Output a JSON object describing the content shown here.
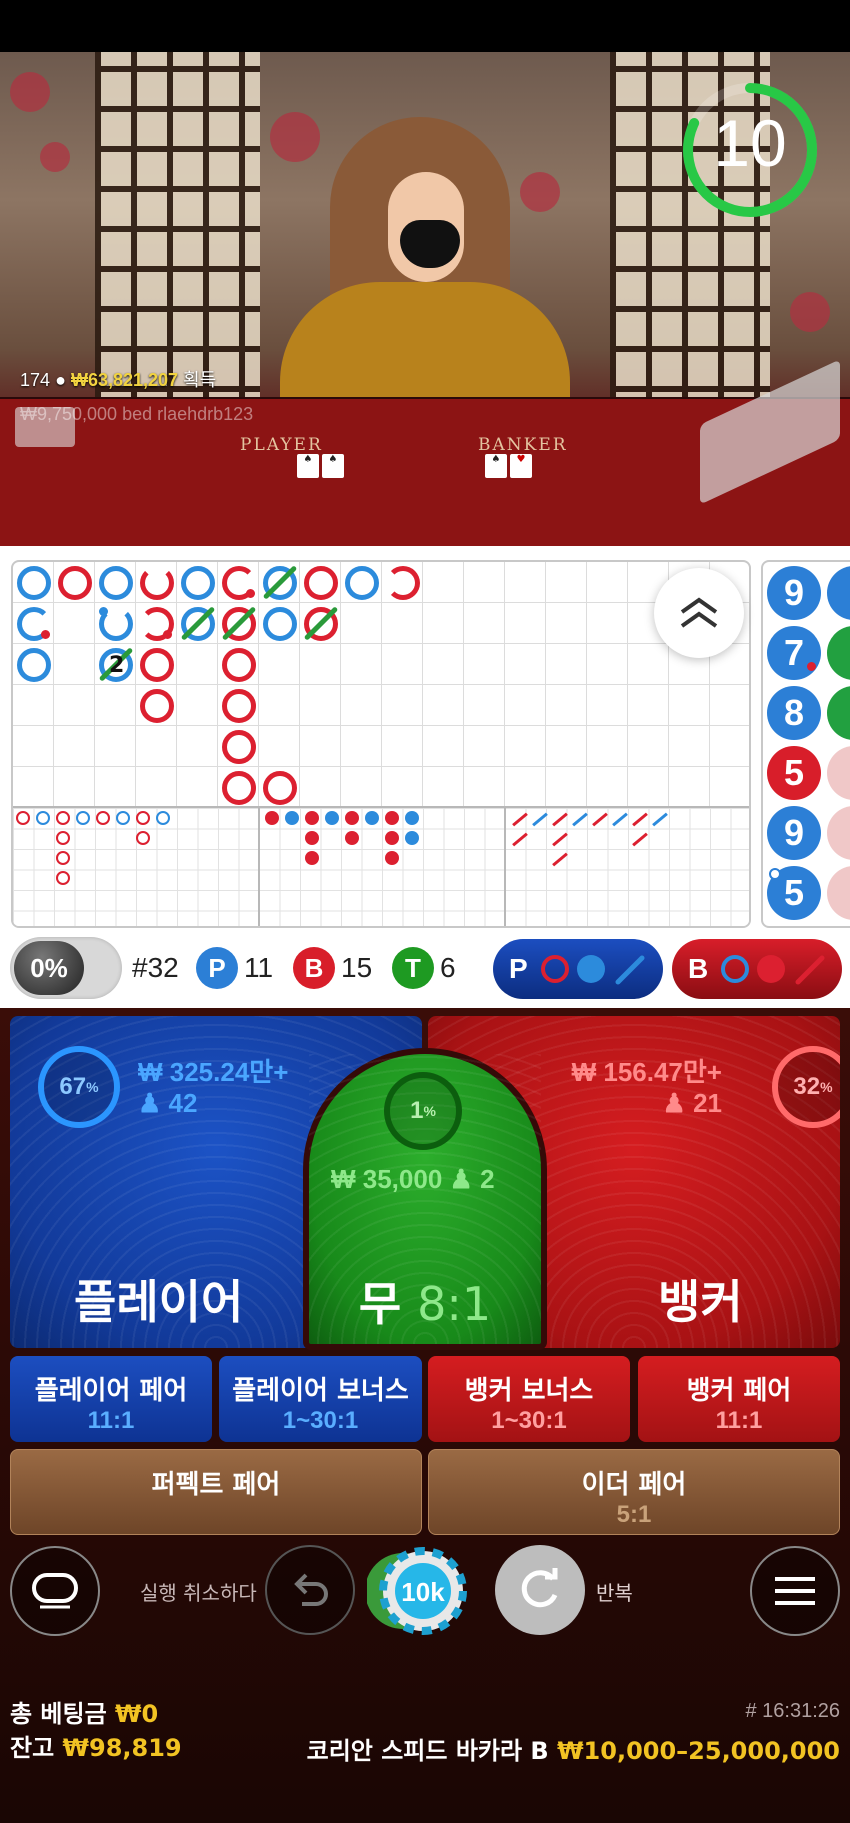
{
  "video": {
    "timer": "10",
    "viewer_count": "174",
    "total_win": "₩63,821,207",
    "total_win_suffix": "획득",
    "winner_ticker": "₩9,750,000  bed  rlaehdrb123",
    "table_player_label": "PLAYER",
    "table_banker_label": "BANKER"
  },
  "roadmap": {
    "bead_values": [
      "9",
      "7",
      "8",
      "5",
      "9",
      "5"
    ],
    "big_road_tie_count": "2"
  },
  "stats": {
    "percent_toggle": "0%",
    "round": "#32",
    "player_badge": "P",
    "player_count": "11",
    "banker_badge": "B",
    "banker_count": "15",
    "tie_badge": "T",
    "tie_count": "6",
    "player_predict": "P",
    "banker_predict": "B"
  },
  "bets": {
    "player": {
      "percent": "67",
      "pct_sign": "%",
      "amount": "₩ 325.24만+",
      "players": "42",
      "title": "플레이어"
    },
    "banker": {
      "percent": "32",
      "pct_sign": "%",
      "amount": "₩ 156.47만+",
      "players": "21",
      "title": "뱅커"
    },
    "tie": {
      "percent": "1",
      "pct_sign": "%",
      "amount": "₩ 35,000",
      "players": "2",
      "title": "무",
      "odds": "8:1"
    },
    "player_pair": {
      "title": "플레이어 페어",
      "odds": "11:1"
    },
    "player_bonus": {
      "title": "플레이어 보너스",
      "odds": "1~30:1"
    },
    "banker_bonus": {
      "title": "뱅커 보너스",
      "odds": "1~30:1"
    },
    "banker_pair": {
      "title": "뱅커 페어",
      "odds": "11:1"
    },
    "perfect_pair": {
      "title": "퍼펙트 페어"
    },
    "either_pair": {
      "title": "이더 페어",
      "odds": "5:1"
    }
  },
  "controls": {
    "undo_label": "실행 취소하다",
    "chip_value": "10k",
    "repeat_label": "반복"
  },
  "footer": {
    "total_bet_label": "총 베팅금",
    "total_bet": "₩0",
    "balance_label": "잔고",
    "balance": "₩98,819",
    "time": "# 16:31:26",
    "table_name": "코리안 스피드 바카라 B",
    "limits": "₩10,000–25,000,000"
  },
  "colors": {
    "player_blue": "#2c7fd6",
    "banker_red": "#d81e2a",
    "tie_green": "#1e9a22",
    "gold": "#f2c323"
  }
}
